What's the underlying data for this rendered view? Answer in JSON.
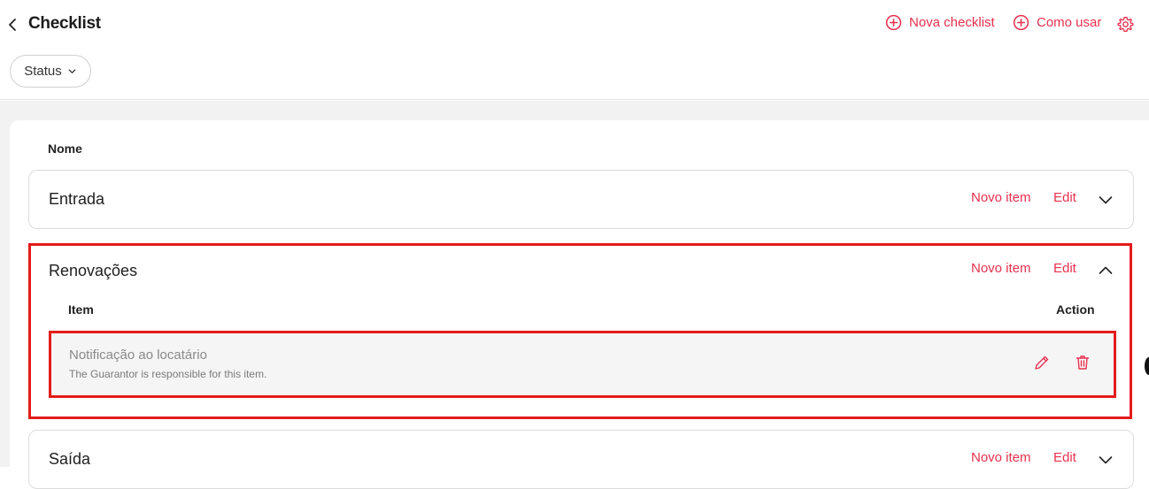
{
  "header": {
    "title": "Checklist",
    "nova_checklist": "Nova checklist",
    "como_usar": "Como usar",
    "status_filter": "Status"
  },
  "table": {
    "column_name": "Nome"
  },
  "groups": [
    {
      "name": "Entrada",
      "new_item": "Novo item",
      "edit": "Edit",
      "expanded": false
    },
    {
      "name": "Renovações",
      "new_item": "Novo item",
      "edit": "Edit",
      "expanded": true,
      "columns": {
        "item": "Item",
        "action": "Action"
      },
      "items": [
        {
          "title": "Notificação ao locatário",
          "subtitle": "The Guarantor is responsible for this item."
        }
      ]
    },
    {
      "name": "Saída",
      "new_item": "Novo item",
      "edit": "Edit",
      "expanded": false
    }
  ],
  "colors": {
    "accent": "#e8304e",
    "highlight": "#e41b1b"
  },
  "icons": [
    "chevron-left-icon",
    "plus-circle-icon",
    "gear-icon",
    "chevron-down-icon",
    "chevron-up-icon",
    "pencil-icon",
    "trash-icon"
  ]
}
